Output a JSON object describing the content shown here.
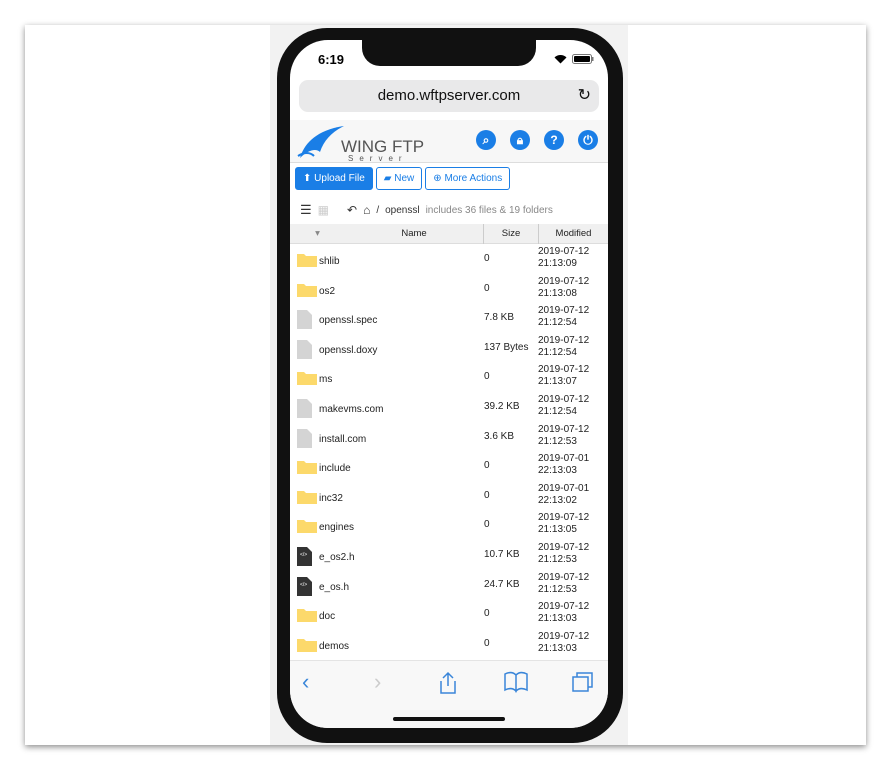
{
  "status_bar": {
    "time": "6:19"
  },
  "browser": {
    "url": "demo.wftpserver.com"
  },
  "header": {
    "logo_text": "WING FTP",
    "logo_sub": "Server",
    "icons": [
      "search-icon",
      "lock-icon",
      "help-icon",
      "power-icon"
    ]
  },
  "actions": {
    "upload": "Upload File",
    "new": "New",
    "more": "More Actions"
  },
  "breadcrumb": {
    "sep": "/",
    "folder": "openssl",
    "info": "includes 36 files & 19 folders"
  },
  "table": {
    "headers": {
      "name": "Name",
      "size": "Size",
      "modified": "Modified"
    },
    "rows": [
      {
        "type": "folder",
        "name": "shlib",
        "size": "0",
        "date": "2019-07-12",
        "time": "21:13:09"
      },
      {
        "type": "folder",
        "name": "os2",
        "size": "0",
        "date": "2019-07-12",
        "time": "21:13:08"
      },
      {
        "type": "file",
        "name": "openssl.spec",
        "size": "7.8 KB",
        "date": "2019-07-12",
        "time": "21:12:54"
      },
      {
        "type": "file",
        "name": "openssl.doxy",
        "size": "137 Bytes",
        "date": "2019-07-12",
        "time": "21:12:54"
      },
      {
        "type": "folder",
        "name": "ms",
        "size": "0",
        "date": "2019-07-12",
        "time": "21:13:07"
      },
      {
        "type": "file",
        "name": "makevms.com",
        "size": "39.2 KB",
        "date": "2019-07-12",
        "time": "21:12:54"
      },
      {
        "type": "file",
        "name": "install.com",
        "size": "3.6 KB",
        "date": "2019-07-12",
        "time": "21:12:53"
      },
      {
        "type": "folder",
        "name": "include",
        "size": "0",
        "date": "2019-07-01",
        "time": "22:13:03"
      },
      {
        "type": "folder",
        "name": "inc32",
        "size": "0",
        "date": "2019-07-01",
        "time": "22:13:02"
      },
      {
        "type": "folder",
        "name": "engines",
        "size": "0",
        "date": "2019-07-12",
        "time": "21:13:05"
      },
      {
        "type": "code",
        "name": "e_os2.h",
        "size": "10.7 KB",
        "date": "2019-07-12",
        "time": "21:12:53"
      },
      {
        "type": "code",
        "name": "e_os.h",
        "size": "24.7 KB",
        "date": "2019-07-12",
        "time": "21:12:53"
      },
      {
        "type": "folder",
        "name": "doc",
        "size": "0",
        "date": "2019-07-12",
        "time": "21:13:03"
      },
      {
        "type": "folder",
        "name": "demos",
        "size": "0",
        "date": "2019-07-12",
        "time": "21:13:03"
      }
    ]
  },
  "colors": {
    "accent": "#1a7ee6",
    "folder": "#fcd96b"
  }
}
